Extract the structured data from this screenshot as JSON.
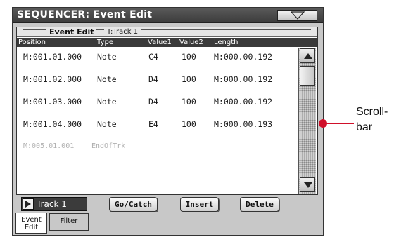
{
  "window": {
    "title": "SEQUENCER: Event Edit"
  },
  "page": {
    "title": "Event Edit",
    "track_name": "T:Track 1"
  },
  "columns": [
    "Position",
    "Type",
    "Value1",
    "Value2",
    "Length"
  ],
  "events": [
    {
      "position": "M:001.01.000",
      "type": "Note",
      "value1": "C4",
      "value2": "100",
      "length": "M:000.00.192"
    },
    {
      "position": "M:001.02.000",
      "type": "Note",
      "value1": "D4",
      "value2": "100",
      "length": "M:000.00.192"
    },
    {
      "position": "M:001.03.000",
      "type": "Note",
      "value1": "D4",
      "value2": "100",
      "length": "M:000.00.192"
    },
    {
      "position": "M:001.04.000",
      "type": "Note",
      "value1": "E4",
      "value2": "100",
      "length": "M:000.00.193"
    },
    {
      "position": "M:005.01.001",
      "type": "EndOfTrk",
      "value1": "",
      "value2": "",
      "length": ""
    }
  ],
  "track_select": {
    "value": "Track 1"
  },
  "buttons": {
    "go_catch": "Go/Catch",
    "insert": "Insert",
    "delete": "Delete"
  },
  "tabs": {
    "event_edit_line1": "Event",
    "event_edit_line2": "Edit",
    "filter": "Filter"
  },
  "callout": {
    "line1": "Scroll-",
    "line2": "bar"
  },
  "colors": {
    "callout": "#d0102a",
    "title_bar": "#3c3c3c",
    "panel": "#c8c8c8"
  },
  "icons": [
    "dropdown-triangle-icon",
    "scroll-up-arrow-icon",
    "scroll-down-arrow-icon",
    "play-arrow-icon"
  ]
}
